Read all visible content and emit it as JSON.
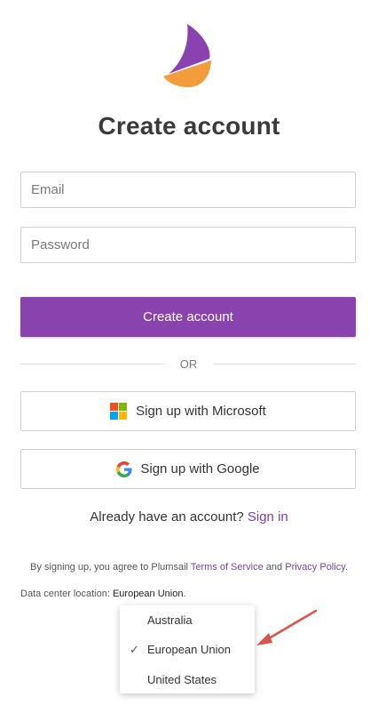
{
  "brand": {
    "primary_color": "#8a43ae",
    "logo_icon": "sail-logo-icon"
  },
  "page": {
    "title": "Create account"
  },
  "form": {
    "email_placeholder": "Email",
    "password_placeholder": "Password",
    "submit_label": "Create account"
  },
  "divider": {
    "label": "OR"
  },
  "social": {
    "microsoft_label": "Sign up with Microsoft",
    "google_label": "Sign up with Google"
  },
  "signin": {
    "prompt": "Already have an account?",
    "link": "Sign in"
  },
  "terms": {
    "prefix": "By signing up, you agree to Plumsail",
    "terms_link": "Terms of Service",
    "and": "and",
    "privacy_link": "Privacy Policy",
    "suffix": "."
  },
  "data_center": {
    "label": "Data center location:",
    "value": "European Union",
    "suffix": ".",
    "options": [
      "Australia",
      "European Union",
      "United States"
    ],
    "selected": "European Union"
  },
  "annotation": {
    "arrow_color": "#d9534f"
  }
}
